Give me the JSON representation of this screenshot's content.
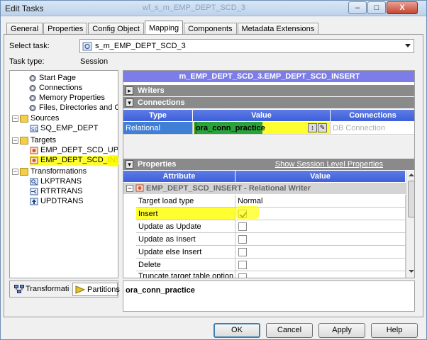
{
  "window": {
    "title": "Edit Tasks",
    "background_title": "wf_s_m_EMP_DEPT_SCD_3",
    "controls": {
      "minimize": "–",
      "maximize": "□",
      "close": "X"
    }
  },
  "tabs": [
    "General",
    "Properties",
    "Config Object",
    "Mapping",
    "Components",
    "Metadata Extensions"
  ],
  "active_tab": "Mapping",
  "form": {
    "select_task_label": "Select task:",
    "select_task_value": "s_m_EMP_DEPT_SCD_3",
    "task_type_label": "Task type:",
    "task_type_value": "Session"
  },
  "tree": {
    "items": [
      {
        "label": "Start Page",
        "icon": "gear-icon"
      },
      {
        "label": "Connections",
        "icon": "gear-icon"
      },
      {
        "label": "Memory Properties",
        "icon": "gear-icon"
      },
      {
        "label": "Files, Directories and Commands",
        "icon": "gear-icon"
      },
      {
        "label": "Sources",
        "icon": "folder-icon"
      },
      {
        "label": "SQ_EMP_DEPT",
        "icon": "source-qualifier-icon"
      },
      {
        "label": "Targets",
        "icon": "folder-icon"
      },
      {
        "label": "EMP_DEPT_SCD_UPDATE",
        "icon": "target-icon"
      },
      {
        "label": "EMP_DEPT_SCD_INSERT",
        "icon": "target-icon"
      },
      {
        "label": "Transformations",
        "icon": "folder-icon"
      },
      {
        "label": "LKPTRANS",
        "icon": "lookup-icon"
      },
      {
        "label": "RTRTRANS",
        "icon": "router-icon"
      },
      {
        "label": "UPDTRANS",
        "icon": "update-strategy-icon"
      }
    ],
    "bottom_tabs": [
      "Transformations",
      "Partitions"
    ]
  },
  "right": {
    "mapping_header": "m_EMP_DEPT_SCD_3.EMP_DEPT_SCD_INSERT",
    "writers_label": "Writers",
    "connections_label": "Connections",
    "conn_columns": [
      "Type",
      "Value",
      "Connections"
    ],
    "conn_row": {
      "type": "Relational",
      "value": "ora_conn_practice",
      "connections": "DB Connection"
    },
    "properties_label": "Properties",
    "show_session_level": "Show Session Level Properties",
    "prop_columns": [
      "Attribute",
      "Value"
    ],
    "writer_group": "EMP_DEPT_SCD_INSERT - Relational Writer",
    "props": [
      {
        "attribute": "Target load type",
        "value": "Normal"
      },
      {
        "attribute": "Insert",
        "checked": true
      },
      {
        "attribute": "Update as Update",
        "checked": false
      },
      {
        "attribute": "Update as Insert",
        "checked": false
      },
      {
        "attribute": "Update else Insert",
        "checked": false
      },
      {
        "attribute": "Delete",
        "checked": false
      },
      {
        "attribute": "Truncate target table option",
        "checked": false
      }
    ],
    "description": "ora_conn_practice"
  },
  "buttons": {
    "ok": "OK",
    "cancel": "Cancel",
    "apply": "Apply",
    "help": "Help"
  },
  "colors": {
    "mapping_header": "#7d7dea",
    "grid_header": "#4a6bdf",
    "highlight": "#ffff30",
    "relational_row": "#3f7fd6"
  }
}
